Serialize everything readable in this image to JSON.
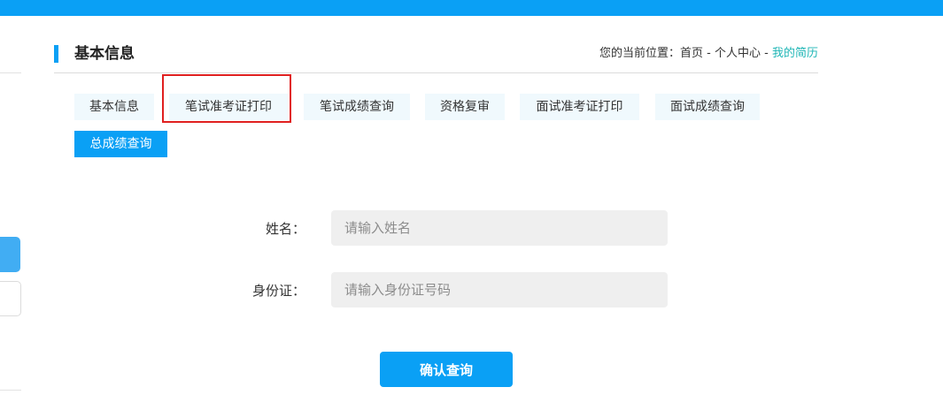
{
  "header": {
    "title": "基本信息",
    "breadcrumb": {
      "prefix": "您的当前位置：",
      "items": [
        "首页",
        "个人中心",
        "我的简历"
      ],
      "separator": " - "
    }
  },
  "tabs": [
    {
      "label": "基本信息",
      "active": false
    },
    {
      "label": "笔试准考证打印",
      "active": false,
      "highlighted": true
    },
    {
      "label": "笔试成绩查询",
      "active": false
    },
    {
      "label": "资格复审",
      "active": false
    },
    {
      "label": "面试准考证打印",
      "active": false
    },
    {
      "label": "面试成绩查询",
      "active": false
    },
    {
      "label": "总成绩查询",
      "active": true
    }
  ],
  "form": {
    "name_label": "姓名：",
    "name_placeholder": "请输入姓名",
    "name_value": "",
    "id_label": "身份证：",
    "id_placeholder": "请输入身份证号码",
    "id_value": "",
    "submit_label": "确认查询"
  },
  "colors": {
    "accent": "#0aa0f5",
    "tab_bg": "#f0f9fd",
    "breadcrumb_current": "#1fb6b6",
    "highlight": "#e02020"
  }
}
